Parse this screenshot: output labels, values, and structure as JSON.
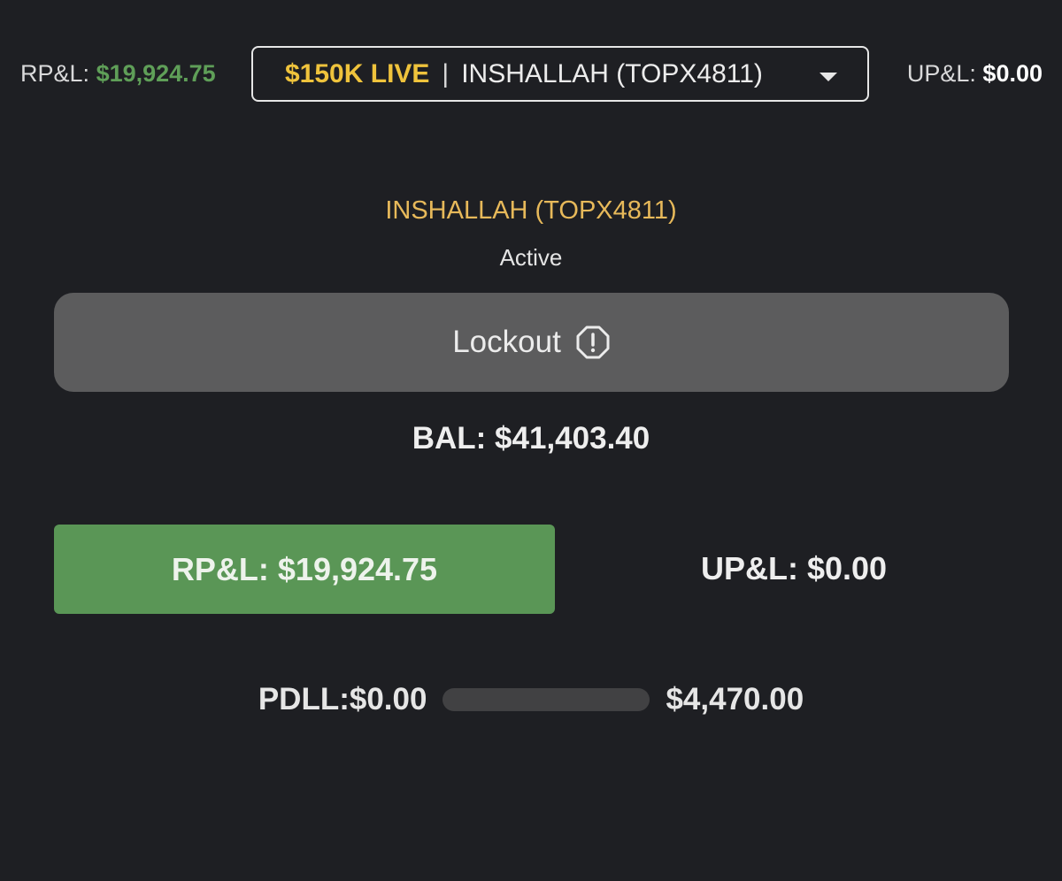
{
  "header": {
    "rpl_label": "RP&L:",
    "rpl_value": "$19,924.75",
    "upl_label": "UP&L:",
    "upl_value": "$0.00",
    "account_select": {
      "plan": "$150K LIVE",
      "separator": "|",
      "account": "INSHALLAH (TOPX4811)",
      "icon": "chevron-down-icon"
    }
  },
  "account": {
    "name": "INSHALLAH (TOPX4811)",
    "status": "Active"
  },
  "lockout": {
    "label": "Lockout",
    "icon": "alert-octagon-icon"
  },
  "balance": {
    "text": "BAL: $41,403.40"
  },
  "pnl": {
    "realized": "RP&L: $19,924.75",
    "unrealized": "UP&L: $0.00"
  },
  "pdll": {
    "label": "PDLL:$0.00",
    "limit": "$4,470.00",
    "progress": 0
  },
  "colors": {
    "background": "#1e1f23",
    "positive": "#5a9656",
    "plan": "#efc33c",
    "account_name": "#e7b95a",
    "lockout_bg": "#5c5c5d"
  }
}
